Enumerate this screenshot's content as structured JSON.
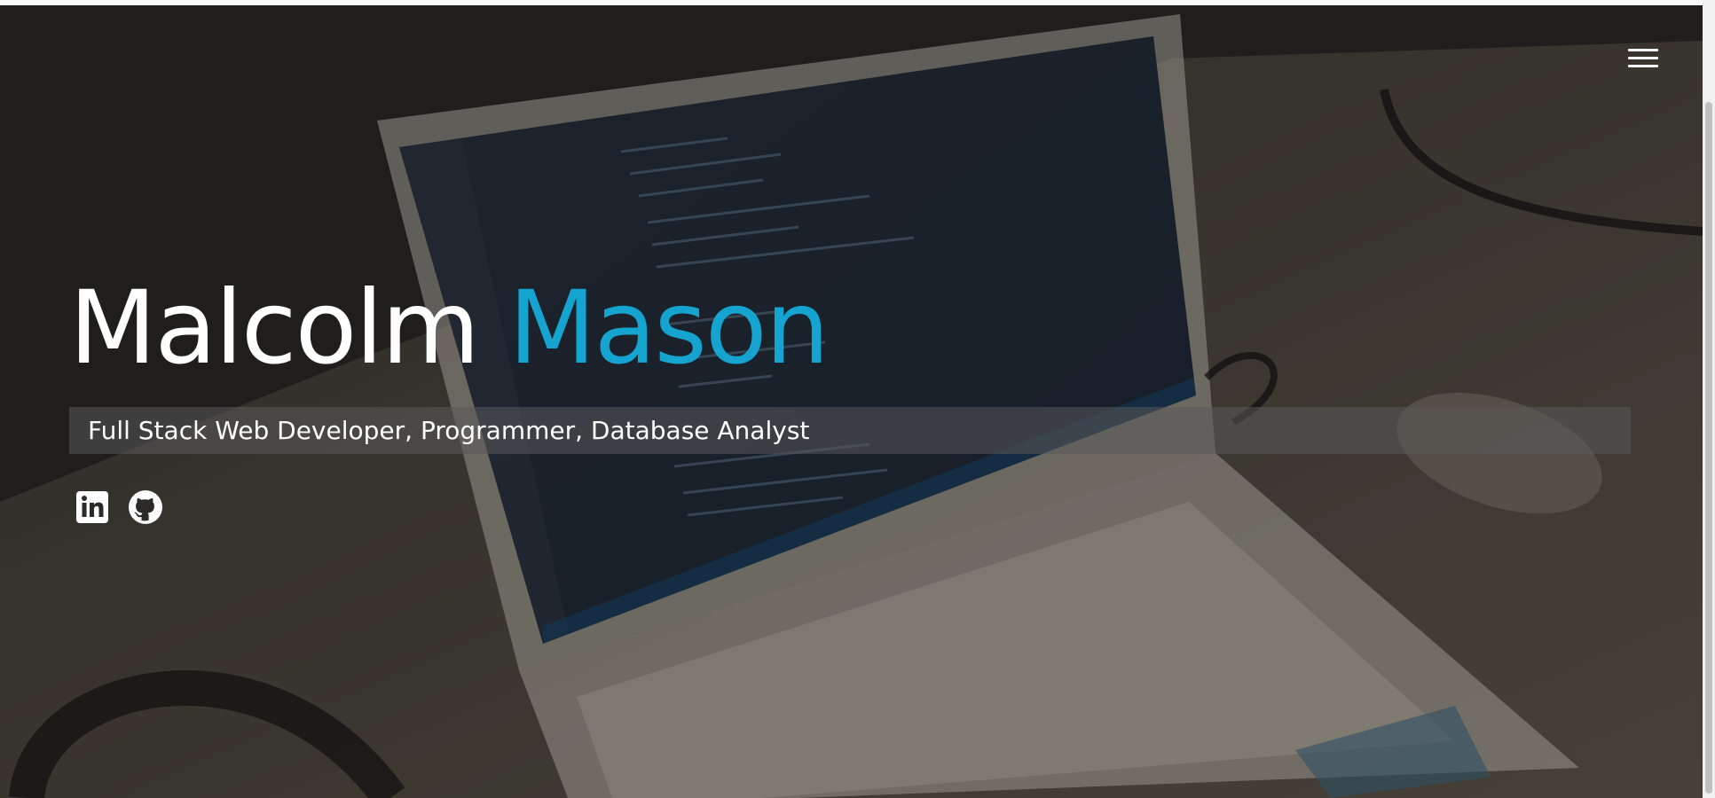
{
  "hero": {
    "name_first": "Malcolm",
    "name_last": "Mason",
    "tagline": "Full Stack Web Developer, Programmer, Database Analyst",
    "accent_color": "#15a3cf"
  },
  "nav": {
    "menu_icon": "hamburger-menu-icon"
  },
  "social": [
    {
      "icon": "linkedin-icon"
    },
    {
      "icon": "github-icon"
    }
  ]
}
